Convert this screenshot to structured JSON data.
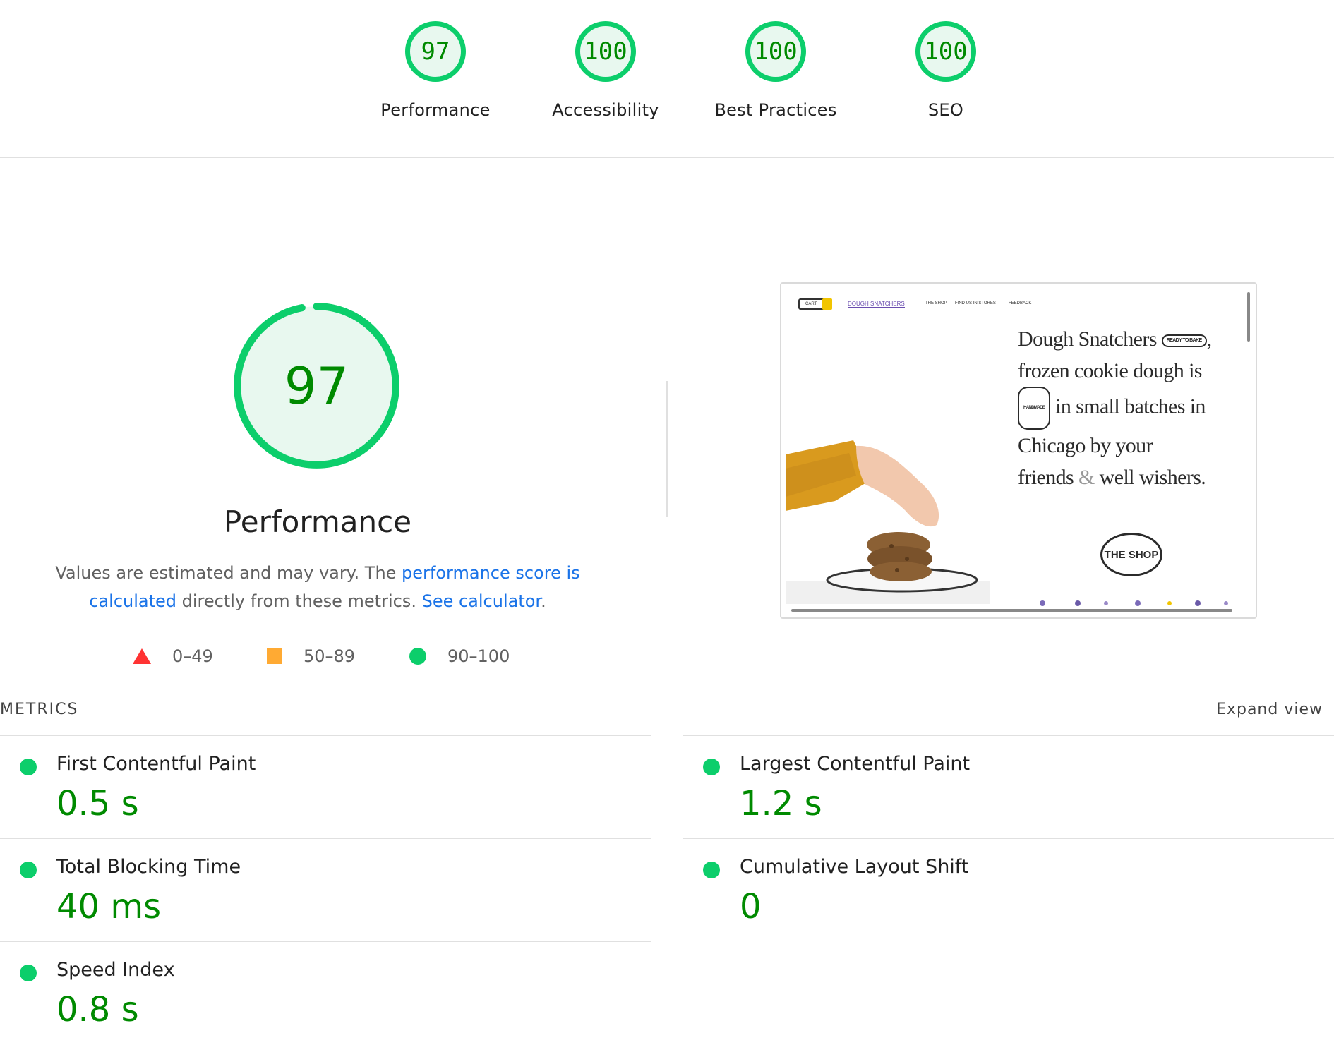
{
  "category_scores": [
    {
      "score": "97",
      "label": "Performance"
    },
    {
      "score": "100",
      "label": "Accessibility"
    },
    {
      "score": "100",
      "label": "Best Practices"
    },
    {
      "score": "100",
      "label": "SEO"
    }
  ],
  "performance": {
    "score": "97",
    "score_fraction": 0.97,
    "title": "Performance",
    "description_prefix": "Values are estimated and may vary. The ",
    "score_link": "performance score is calculated",
    "description_middle": " directly from these metrics. ",
    "calculator_link": "See calculator",
    "description_suffix": "."
  },
  "legend": {
    "fail": "0–49",
    "average": "50–89",
    "pass": "90–100"
  },
  "screenshot": {
    "cart": "CART",
    "brand": "DOUGH SNATCHERS",
    "nav": [
      "THE SHOP",
      "FIND US IN STORES",
      "FEEDBACK"
    ],
    "headline": "Dough Snatchers (READY TO BAKE), frozen cookie dough is (HANDMADE) in small batches in Chicago by your friends & well wishers.",
    "headline_lines": [
      "Dough Snatchers",
      "frozen cookie dough is",
      "in small batches in",
      "Chicago by your",
      "friends",
      "well wishers."
    ],
    "badge_ready": "READY TO BAKE",
    "badge_handmade": "HANDMADE",
    "shop_button": "THE SHOP"
  },
  "metrics": {
    "header": "METRICS",
    "expand_label": "Expand view",
    "items": [
      {
        "title": "First Contentful Paint",
        "value": "0.5 s"
      },
      {
        "title": "Largest Contentful Paint",
        "value": "1.2 s"
      },
      {
        "title": "Total Blocking Time",
        "value": "40 ms"
      },
      {
        "title": "Cumulative Layout Shift",
        "value": "0"
      },
      {
        "title": "Speed Index",
        "value": "0.8 s"
      }
    ]
  },
  "colors": {
    "pass": "#0cce6b",
    "pass_text": "#008a00",
    "average": "#ffaa33",
    "fail": "#ff3333",
    "link": "#1a73e8"
  }
}
